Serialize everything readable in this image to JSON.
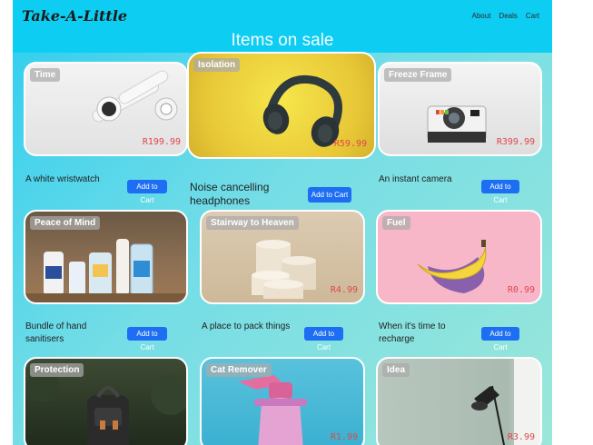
{
  "brand": "Take-A-Little",
  "nav": [
    "About",
    "Deals",
    "Cart"
  ],
  "page_title": "Items on sale",
  "cart_label": "Add to Cart",
  "items": [
    {
      "tag": "Time",
      "price": "R199.99",
      "desc": "A white wristwatch",
      "icon": "wristwatch-image"
    },
    {
      "tag": "Isolation",
      "price": "R59.99",
      "desc": "Noise cancelling headphones",
      "icon": "headphones-image"
    },
    {
      "tag": "Freeze Frame",
      "price": "R399.99",
      "desc": "An instant camera",
      "icon": "instant-camera-image"
    },
    {
      "tag": "Peace of Mind",
      "price": "",
      "desc": "Bundle of hand sanitisers",
      "icon": "sanitiser-bottles-image"
    },
    {
      "tag": "Stairway to Heaven",
      "price": "R4.99",
      "desc": "A place to pack things",
      "icon": "pedestal-steps-image"
    },
    {
      "tag": "Fuel",
      "price": "R0.99",
      "desc": "When it's time to recharge",
      "icon": "banana-image"
    },
    {
      "tag": "Protection",
      "price": "",
      "desc": "",
      "icon": "backpack-image"
    },
    {
      "tag": "Cat Remover",
      "price": "R1.99",
      "desc": "",
      "icon": "spray-bottle-image"
    },
    {
      "tag": "Idea",
      "price": "R3.99",
      "desc": "",
      "icon": "desk-lamp-image"
    }
  ]
}
